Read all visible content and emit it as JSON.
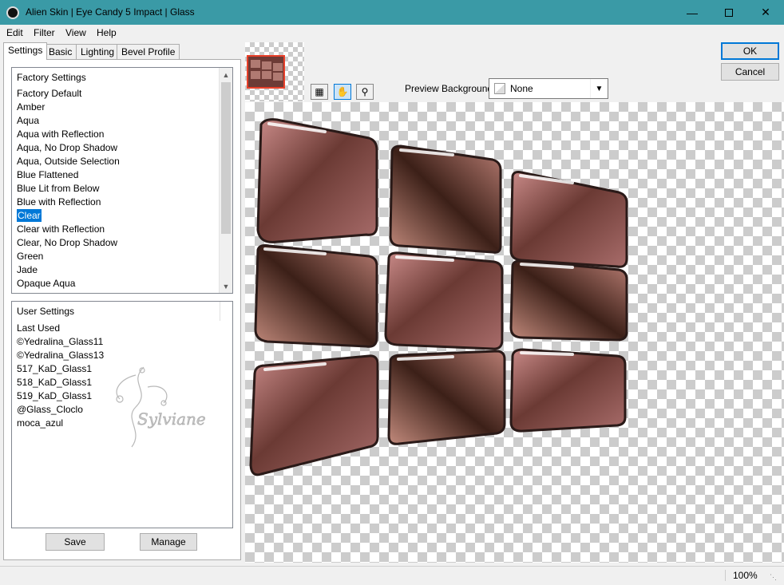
{
  "window": {
    "title": "Alien Skin | Eye Candy 5 Impact | Glass"
  },
  "menu": {
    "items": [
      "Edit",
      "Filter",
      "View",
      "Help"
    ]
  },
  "tabs": [
    "Settings",
    "Basic",
    "Lighting",
    "Bevel Profile"
  ],
  "factory": {
    "header": "Factory Settings",
    "items": [
      "Factory Default",
      "Amber",
      "Aqua",
      "Aqua with Reflection",
      "Aqua, No Drop Shadow",
      "Aqua, Outside Selection",
      "Blue Flattened",
      "Blue Lit from Below",
      "Blue with Reflection",
      "Clear",
      "Clear with Reflection",
      "Clear, No Drop Shadow",
      "Green",
      "Jade",
      "Opaque Aqua"
    ],
    "selected": "Clear"
  },
  "user": {
    "header": "User Settings",
    "items": [
      "Last Used",
      "©Yedralina_Glass11",
      "©Yedralina_Glass13",
      "517_KaD_Glass1",
      "518_KaD_Glass1",
      "519_KaD_Glass1",
      "@Glass_Cloclo",
      "moca_azul"
    ],
    "watermark": "Sylviane"
  },
  "buttons": {
    "save": "Save",
    "manage": "Manage",
    "ok": "OK",
    "cancel": "Cancel"
  },
  "preview_background": {
    "label": "Preview Background:",
    "value": "None"
  },
  "status": {
    "zoom": "100%"
  },
  "colors": {
    "titlebar": "#3a9aa6",
    "selection": "#0078d7",
    "accent_red": "#e8402a"
  }
}
